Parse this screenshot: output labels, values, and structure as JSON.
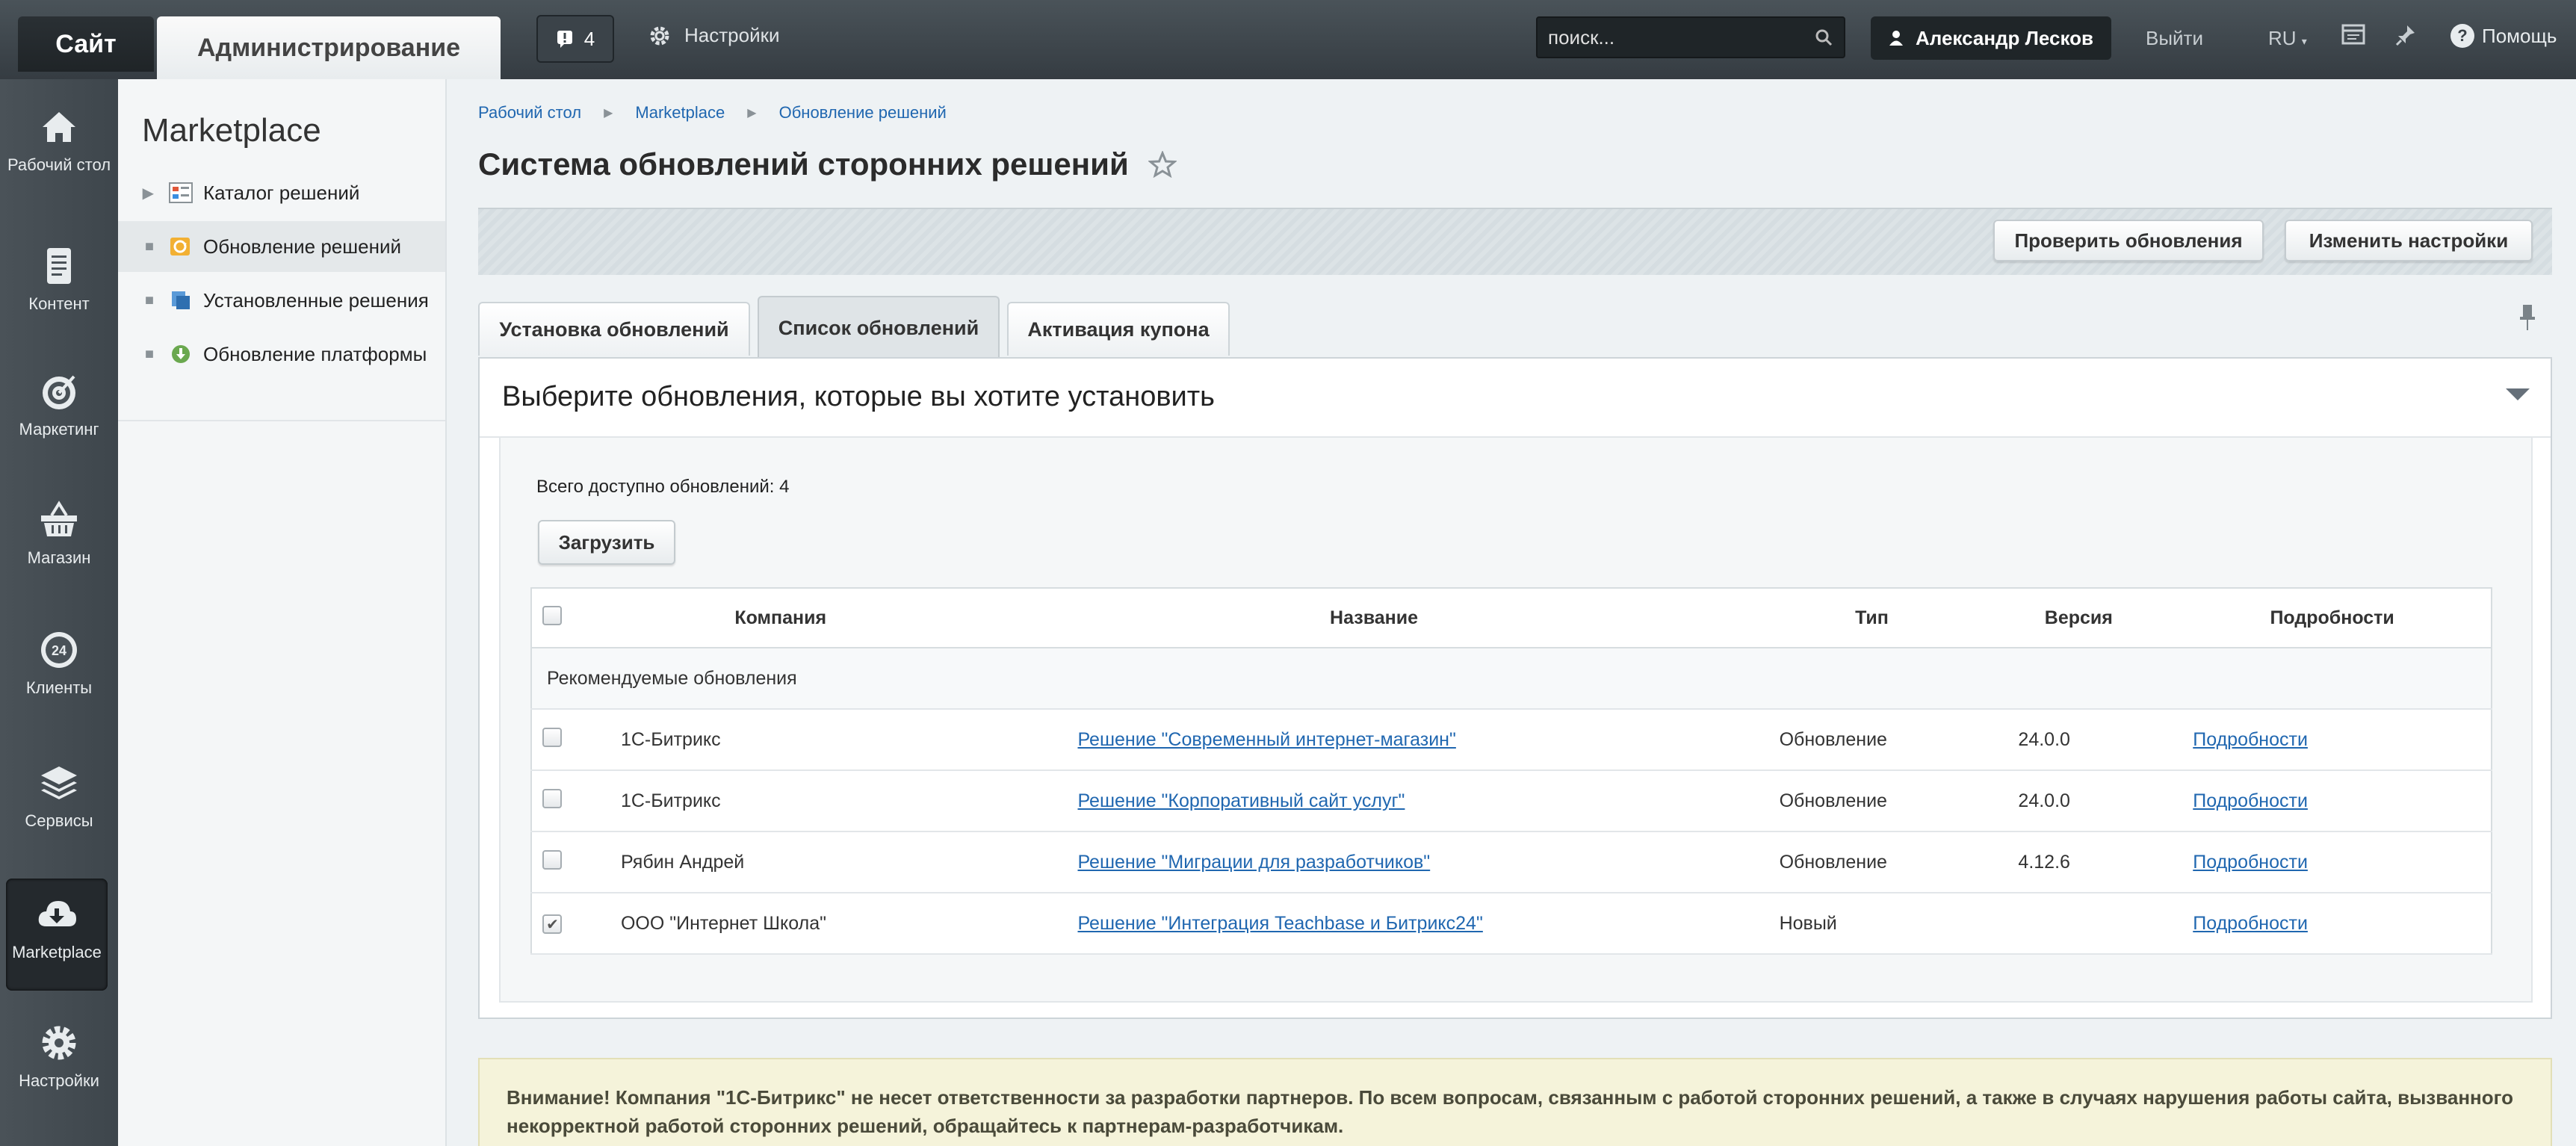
{
  "topbar": {
    "site_label": "Сайт",
    "admin_label": "Администрирование",
    "notifications_count": "4",
    "settings_label": "Настройки",
    "search_placeholder": "поиск...",
    "user_name": "Александр Лесков",
    "logout_label": "Выйти",
    "language": "RU",
    "help_label": "Помощь"
  },
  "leftnav": {
    "items": [
      {
        "label": "Рабочий стол",
        "icon": "home-icon"
      },
      {
        "label": "Контент",
        "icon": "document-icon"
      },
      {
        "label": "Маркетинг",
        "icon": "target-icon"
      },
      {
        "label": "Магазин",
        "icon": "basket-icon"
      },
      {
        "label": "Клиенты",
        "icon": "clock-24-icon"
      },
      {
        "label": "Сервисы",
        "icon": "layers-icon"
      },
      {
        "label": "Marketplace",
        "icon": "cloud-download-icon"
      },
      {
        "label": "Настройки",
        "icon": "gear-icon"
      }
    ],
    "active_index": 6
  },
  "sidebar": {
    "title": "Marketplace",
    "items": [
      {
        "label": "Каталог решений"
      },
      {
        "label": "Обновление решений"
      },
      {
        "label": "Установленные решения"
      },
      {
        "label": "Обновление платформы"
      }
    ],
    "active_index": 1
  },
  "breadcrumb": [
    "Рабочий стол",
    "Marketplace",
    "Обновление решений"
  ],
  "page": {
    "title": "Система обновлений сторонних решений",
    "check_updates_label": "Проверить обновления",
    "change_settings_label": "Изменить настройки"
  },
  "tabs": [
    {
      "label": "Установка обновлений"
    },
    {
      "label": "Список обновлений"
    },
    {
      "label": "Активация купона"
    }
  ],
  "panel": {
    "title": "Выберите обновления, которые вы хотите установить",
    "total_text": "Всего доступно обновлений: 4",
    "load_label": "Загрузить"
  },
  "table": {
    "columns": [
      "Компания",
      "Название",
      "Тип",
      "Версия",
      "Подробности"
    ],
    "group_label": "Рекомендуемые обновления",
    "rows": [
      {
        "company": "1С-Битрикс",
        "name": "Решение \"Современный интернет-магазин\"",
        "type": "Обновление",
        "version": "24.0.0",
        "details": "Подробности",
        "checked": false
      },
      {
        "company": "1С-Битрикс",
        "name": "Решение \"Корпоративный сайт услуг\"",
        "type": "Обновление",
        "version": "24.0.0",
        "details": "Подробности",
        "checked": false
      },
      {
        "company": "Рябин Андрей",
        "name": "Решение \"Миграции для разработчиков\"",
        "type": "Обновление",
        "version": "4.12.6",
        "details": "Подробности",
        "checked": false
      },
      {
        "company": "ООО \"Интернет Школа\"",
        "name": "Решение \"Интеграция Teachbase и Битрикс24\"",
        "type": "Новый",
        "version": "",
        "details": "Подробности",
        "checked": true
      }
    ]
  },
  "warning": {
    "text": "Внимание! Компания \"1С-Битрикс\" не несет ответственности за разработки партнеров. По всем вопросам, связанным с работой сторонних решений, а также в случаях нарушения работы сайта, вызванного некорректной работой сторонних решений, обращайтесь к партнерам-разработчикам."
  },
  "colors": {
    "accent_link": "#2067b0",
    "topbar": "#3e464c",
    "warning_bg": "#f5f3da"
  }
}
